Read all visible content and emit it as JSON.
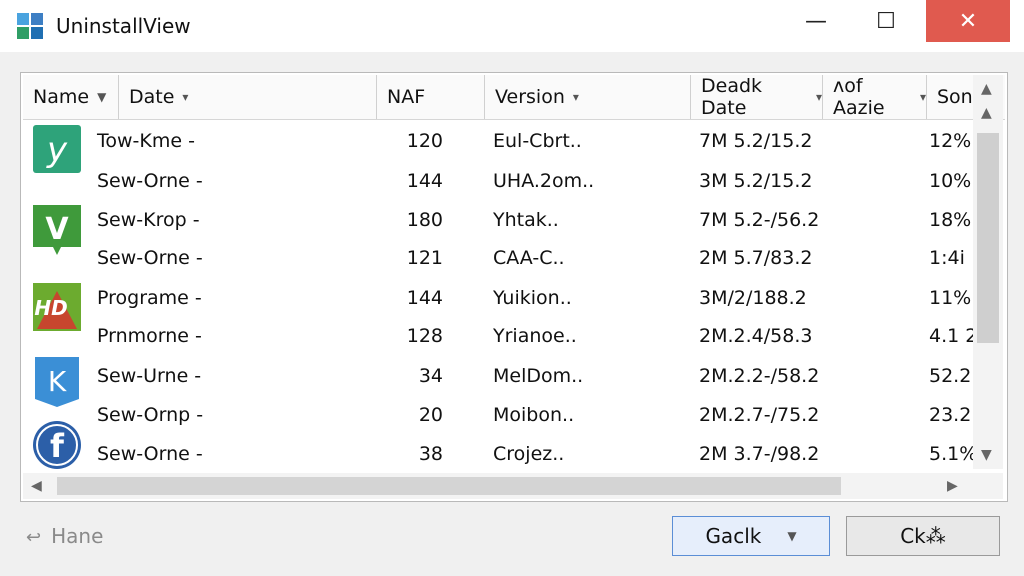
{
  "window": {
    "title": "UninstallView",
    "minimize_glyph": "—",
    "maximize_glyph": "☐",
    "close_glyph": "✕"
  },
  "columns": [
    {
      "label": "Name",
      "sort": "▼"
    },
    {
      "label": "Date",
      "sort": "▾"
    },
    {
      "label": "NAF",
      "sort": ""
    },
    {
      "label": "Version",
      "sort": "▾"
    },
    {
      "label": "Deadk Date",
      "sort": "▾"
    },
    {
      "label": "ᴧof Aazie",
      "sort": "▾"
    },
    {
      "label": "Son",
      "sort": ""
    }
  ],
  "rows": [
    {
      "name": "Tow-Kme -",
      "naf": "120",
      "version": "Eul-Cbrt..",
      "date": "7M 5.2/15.2",
      "size": "12%"
    },
    {
      "name": "Sew-Orne -",
      "naf": "144",
      "version": "UHA.2om..",
      "date": "3M 5.2/15.2",
      "size": "10%"
    },
    {
      "name": "Sew-Krop -",
      "naf": "180",
      "version": "Yhtak..",
      "date": "7M 5.2-/56.2",
      "size": "18%"
    },
    {
      "name": "Sew-Orne -",
      "naf": "121",
      "version": "CAA-C..",
      "date": "2M 5.7/83.2",
      "size": "1:4i"
    },
    {
      "name": "Programe -",
      "naf": "144",
      "version": "Yuikion..",
      "date": "3M/2/188.2",
      "size": "11%"
    },
    {
      "name": "Prnmorne -",
      "naf": "128",
      "version": "Yrianoe..",
      "date": "2M.2.4/58.3",
      "size": "4.1 2"
    },
    {
      "name": "Sew-Urne -",
      "naf": "34",
      "version": "MelDom..",
      "date": "2M.2.2-/58.2",
      "size": "52.2"
    },
    {
      "name": "Sew-Ornp -",
      "naf": "20",
      "version": "Moibon..",
      "date": "2M.2.7-/75.2",
      "size": "23.2"
    },
    {
      "name": "Sew-Orne -",
      "naf": "38",
      "version": "Crojez..",
      "date": "2M 3.7-/98.2",
      "size": "5.1%"
    }
  ],
  "icons": [
    {
      "name": "green-y-app-icon",
      "letter": "y",
      "color": "#2ea37a"
    },
    {
      "name": "green-v-app-icon",
      "letter": "V",
      "color": "#3f9a3b"
    },
    {
      "name": "hd-app-icon",
      "letter": "HD",
      "color": "#6cab2f"
    },
    {
      "name": "blue-k-app-icon",
      "letter": "K",
      "color": "#3b8fd6"
    },
    {
      "name": "blue-f-app-icon",
      "letter": "f",
      "color": "#2c5fa8"
    }
  ],
  "footer": {
    "left_label": "Hane",
    "back_label": "Gaclk",
    "ok_label": "Ck⁂"
  },
  "colors": {
    "close_button": "#e05a4f",
    "accent_border": "#5b8ed6"
  }
}
